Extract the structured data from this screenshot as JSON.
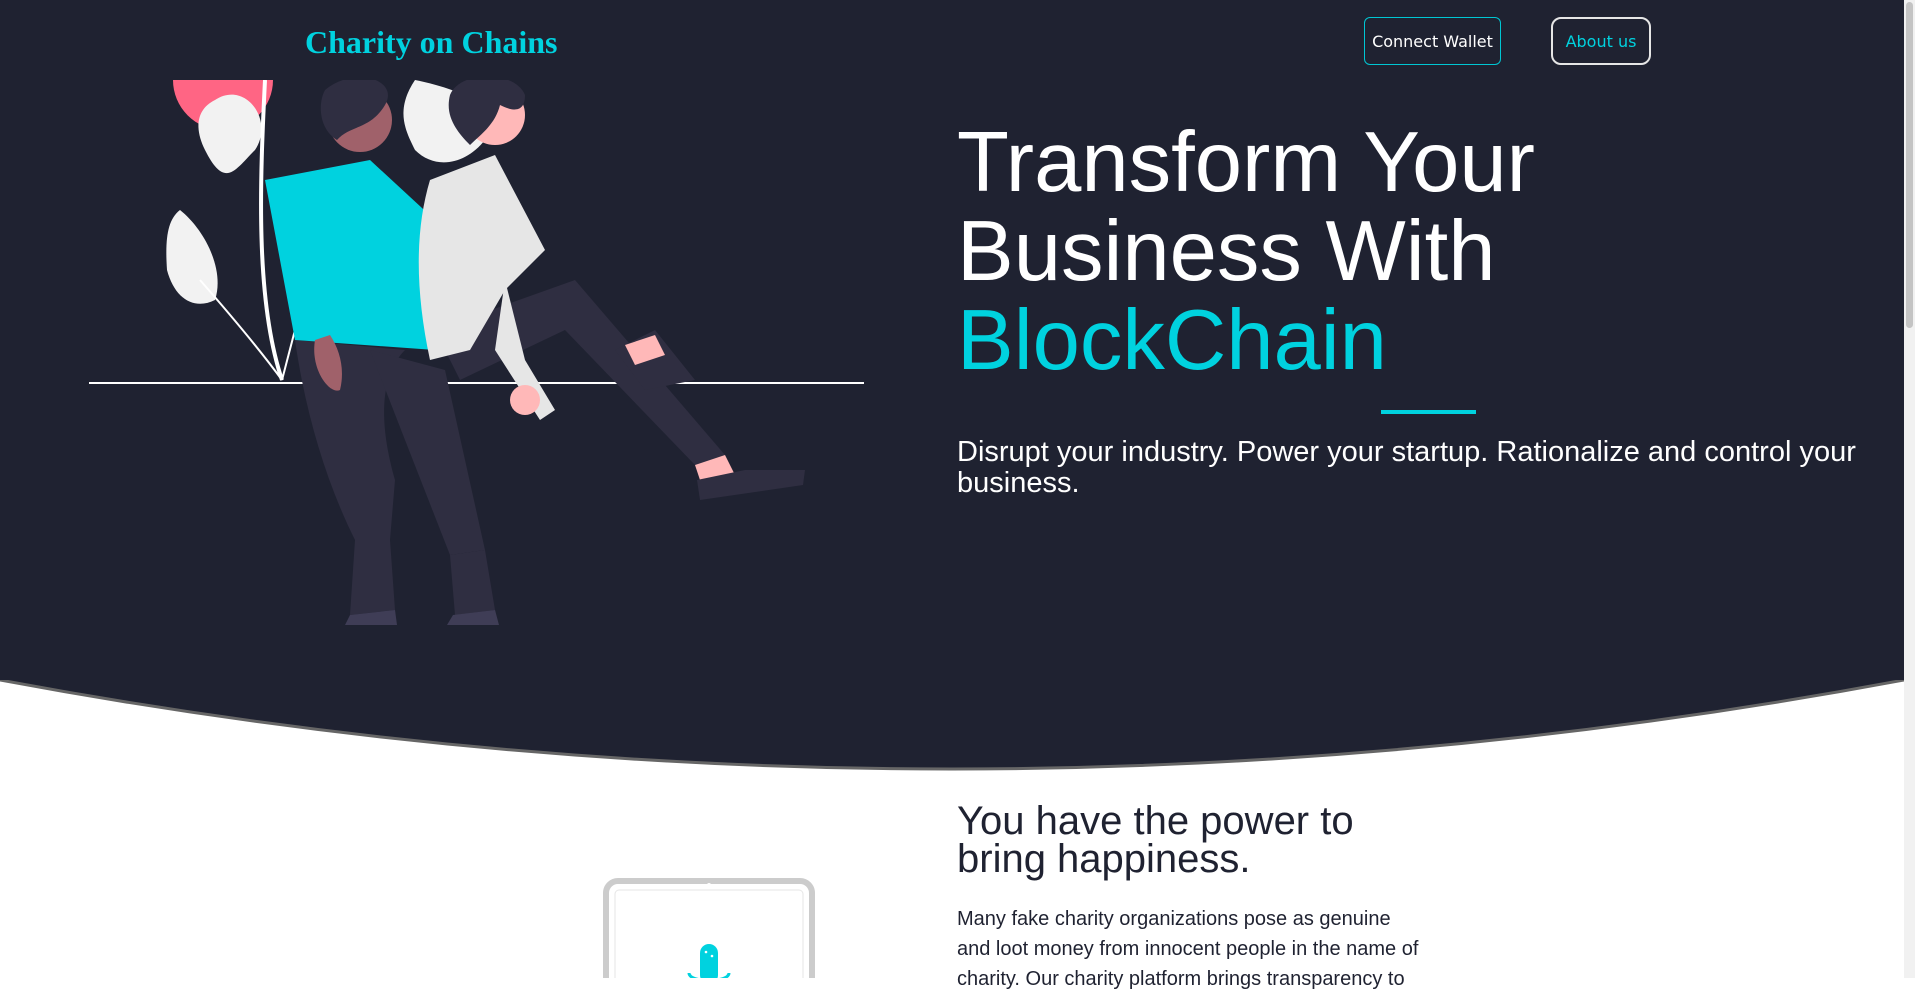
{
  "header": {
    "brand": "Charity on Chains",
    "connect_wallet_label": "Connect Wallet",
    "about_label": "About us"
  },
  "hero": {
    "title_line1": "Transform Your",
    "title_line2": "Business With",
    "title_accent": "BlockChain",
    "subtitle": "Disrupt your industry. Power your startup. Rationalize and control your business."
  },
  "section": {
    "title": "You have the power to bring happiness.",
    "text": "Many fake charity organizations pose as genuine and loot money from innocent people in the name of charity. Our charity platform brings transparency to"
  },
  "icons": {
    "hero_illustration": "two-people-sitting-illustration",
    "laptop": "laptop-illustration"
  },
  "colors": {
    "background_dark": "#1f2231",
    "accent": "#00d2df",
    "text_light": "#ffffff"
  }
}
